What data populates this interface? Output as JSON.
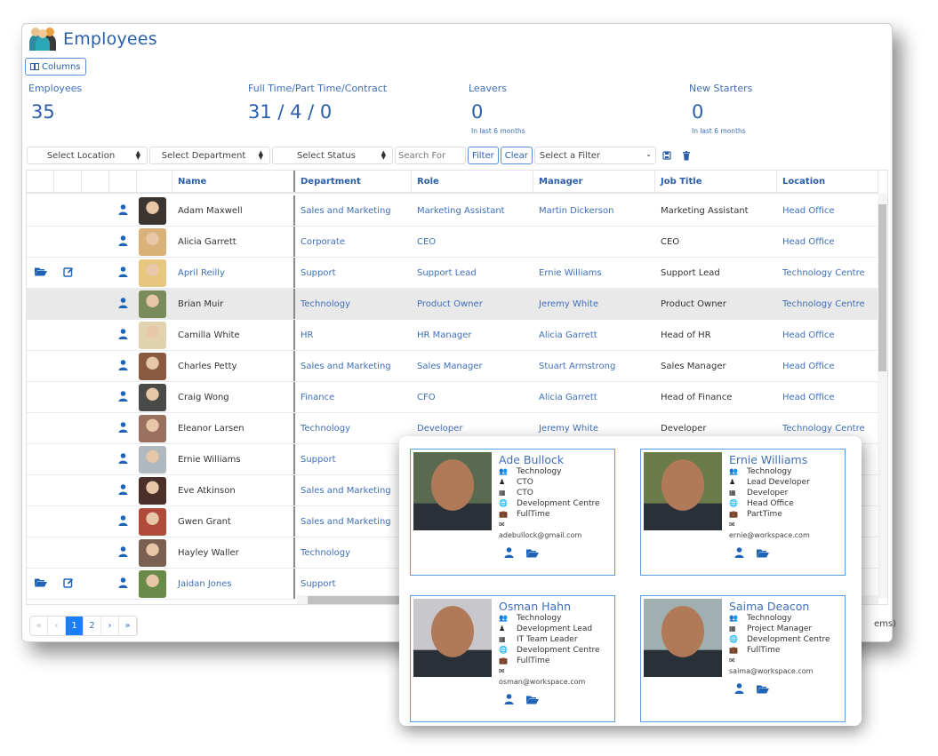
{
  "header": {
    "title": "Employees",
    "icon": "people-group-icon"
  },
  "toolbar": {
    "columns_label": "Columns"
  },
  "stats": [
    {
      "label": "Employees",
      "value": "35",
      "sub": ""
    },
    {
      "label": "Full Time/Part Time/Contract",
      "value": "31 / 4 / 0",
      "sub": ""
    },
    {
      "label": "Leavers",
      "value": "0",
      "sub": "In last 6 months"
    },
    {
      "label": "New Starters",
      "value": "0",
      "sub": "In last 6 months"
    }
  ],
  "filters": {
    "location": "Select Location",
    "department": "Select Department",
    "status": "Select Status",
    "search_placeholder": "Search For",
    "filter_label": "Filter",
    "clear_label": "Clear",
    "saved_filter": "Select a Filter"
  },
  "grid": {
    "columns": [
      "Name",
      "Department",
      "Role",
      "Manager",
      "Job Title",
      "Location"
    ],
    "rows": [
      {
        "name": "Adam Maxwell",
        "name_link": false,
        "actions": false,
        "department": "Sales and Marketing",
        "role": "Marketing Assistant",
        "manager": "Martin Dickerson",
        "job_title": "Marketing Assistant",
        "location": "Head Office",
        "avatar": "#3a3530"
      },
      {
        "name": "Alicia Garrett",
        "name_link": false,
        "actions": false,
        "department": "Corporate",
        "role": "CEO",
        "manager": "",
        "job_title": "CEO",
        "location": "Head Office",
        "avatar": "#d9b27a"
      },
      {
        "name": "April Reilly",
        "name_link": true,
        "actions": true,
        "department": "Support",
        "role": "Support Lead",
        "manager": "Ernie Williams",
        "job_title": "Support Lead",
        "location": "Technology Centre",
        "avatar": "#e6c77d"
      },
      {
        "name": "Brian Muir",
        "name_link": false,
        "actions": false,
        "department": "Technology",
        "role": "Product Owner",
        "manager": "Jeremy White",
        "job_title": "Product Owner",
        "location": "Technology Centre",
        "avatar": "#7a8a5a",
        "highlight": true
      },
      {
        "name": "Camilla White",
        "name_link": false,
        "actions": false,
        "department": "HR",
        "role": "HR Manager",
        "manager": "Alicia Garrett",
        "job_title": "Head of HR",
        "location": "Head Office",
        "avatar": "#e2d3b0"
      },
      {
        "name": "Charles Petty",
        "name_link": false,
        "actions": false,
        "department": "Sales and Marketing",
        "role": "Sales Manager",
        "manager": "Stuart Armstrong",
        "job_title": "Sales Manager",
        "location": "Head Office",
        "avatar": "#8a5a40"
      },
      {
        "name": "Craig Wong",
        "name_link": false,
        "actions": false,
        "department": "Finance",
        "role": "CFO",
        "manager": "Alicia Garrett",
        "job_title": "Head of Finance",
        "location": "Head Office",
        "avatar": "#4a4a48"
      },
      {
        "name": "Eleanor Larsen",
        "name_link": false,
        "actions": false,
        "department": "Technology",
        "role": "Developer",
        "manager": "Jeremy White",
        "job_title": "Developer",
        "location": "Technology Centre",
        "avatar": "#9a7060"
      },
      {
        "name": "Ernie Williams",
        "name_link": false,
        "actions": false,
        "department": "Support",
        "role": "",
        "manager": "",
        "job_title": "",
        "location": "",
        "avatar": "#b0b8c0"
      },
      {
        "name": "Eve Atkinson",
        "name_link": false,
        "actions": false,
        "department": "Sales and Marketing",
        "role": "",
        "manager": "",
        "job_title": "",
        "location": "",
        "avatar": "#4a3028"
      },
      {
        "name": "Gwen Grant",
        "name_link": false,
        "actions": false,
        "department": "Sales and Marketing",
        "role": "",
        "manager": "",
        "job_title": "",
        "location": "",
        "avatar": "#b04a3a"
      },
      {
        "name": "Hayley Waller",
        "name_link": false,
        "actions": false,
        "department": "Technology",
        "role": "",
        "manager": "",
        "job_title": "",
        "location": "",
        "avatar": "#7a6050"
      },
      {
        "name": "Jaidan Jones",
        "name_link": true,
        "actions": true,
        "department": "Support",
        "role": "",
        "manager": "",
        "job_title": "",
        "location": "",
        "avatar": "#6a8a4a"
      }
    ]
  },
  "pagination": {
    "pages": [
      "«",
      "‹",
      "1",
      "2",
      "›",
      "»"
    ],
    "active": "1",
    "items_text_partial": "ems)"
  },
  "popup_cards": [
    {
      "name": "Ade Bullock",
      "department": "Technology",
      "role": "CTO",
      "job_title": "CTO",
      "location": "Development Centre",
      "status": "FullTime",
      "email": "adebullock@gmail.com",
      "photo": "#5a6a50"
    },
    {
      "name": "Ernie Williams",
      "department": "Technology",
      "role": "Lead Developer",
      "job_title": "Developer",
      "location": "Head Office",
      "status": "PartTime",
      "email": "ernie@workspace.com",
      "photo": "#6a7a48"
    },
    {
      "name": "Osman Hahn",
      "department": "Technology",
      "role": "Development Lead",
      "job_title": "IT Team Leader",
      "location": "Development Centre",
      "status": "FullTime",
      "email": "osman@workspace.com",
      "photo": "#c8c8cc"
    },
    {
      "name": "Saima Deacon",
      "department": "Technology",
      "role": "",
      "job_title": "Project Manager",
      "location": "Development Centre",
      "status": "FullTime",
      "email": "saima@workspace.com",
      "photo": "#a0b0b0"
    }
  ],
  "colors": {
    "accent": "#2a5ea8",
    "link": "#3f6fb8",
    "active_page": "#1a7ef5",
    "card_border": "#5a9be6"
  }
}
